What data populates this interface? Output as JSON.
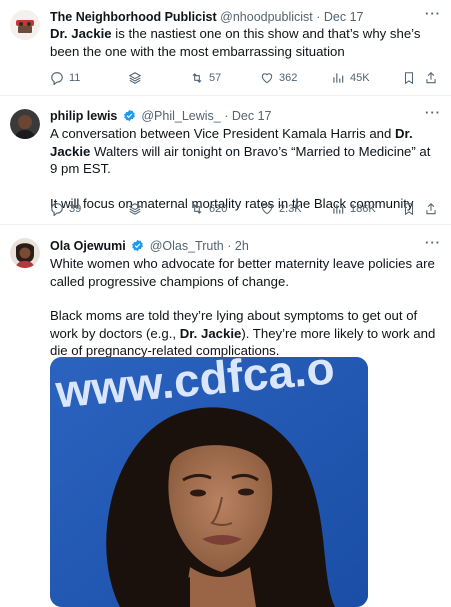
{
  "tweets": [
    {
      "name": "The Neighborhood Publicist",
      "handle": "@nhoodpublicist",
      "time": "Dec 17",
      "verified": false,
      "body": [
        "Dr. Jackie is the nastiest one on this show and that's why she's been the one with the most embarrassing situation"
      ],
      "bold_terms": [
        "Dr. Jackie"
      ],
      "actions": {
        "replies": "11",
        "retweets": "57",
        "likes": "362",
        "views": "45K"
      }
    },
    {
      "name": "philip lewis",
      "handle": "@Phil_Lewis_",
      "time": "Dec 17",
      "verified": true,
      "body": [
        "A conversation between Vice President Kamala Harris and Dr. Jackie Walters will air tonight on Bravo's “Married to Medicine” at 9 pm EST.",
        "It will focus on maternal mortality rates in the Black community"
      ],
      "actions": {
        "replies": "39",
        "retweets": "620",
        "likes": "2.3K",
        "views": "186K"
      }
    },
    {
      "name": "Ola Ojewumi",
      "handle": "@Olas_Truth",
      "time": "2h",
      "verified": true,
      "body": [
        "White women who advocate for better maternity leave policies are called progressive champions of change.",
        "Black moms are told they're lying about symptoms to get out of work by doctors (e.g., Dr. Jackie). They're more likely to work and die of pregnancy-related complications."
      ],
      "media": {
        "banner_text": "www.cdfca.o"
      }
    }
  ],
  "separator": "·",
  "more_icon": "···",
  "colors": {
    "text": "#0f1419",
    "muted": "#536471",
    "verified": "#1d9bf0",
    "banner": "#1f58b5"
  }
}
